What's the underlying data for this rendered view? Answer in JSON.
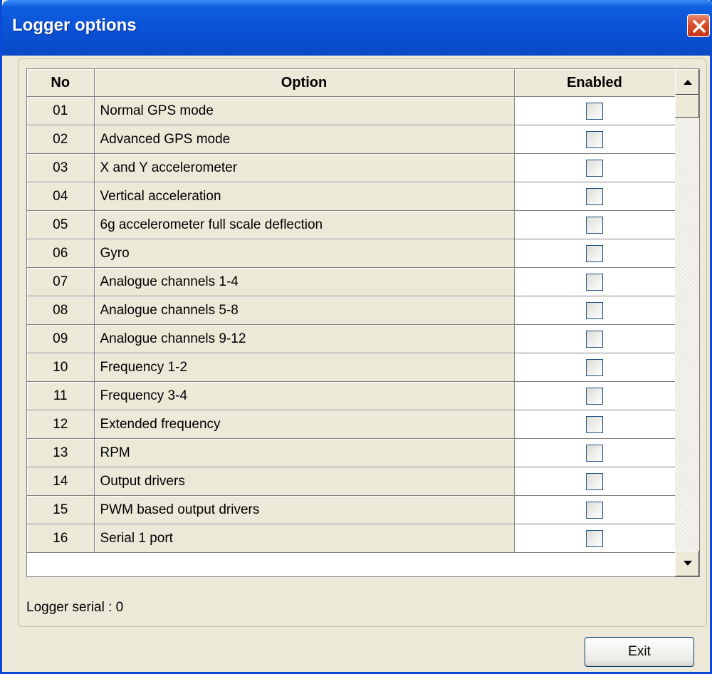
{
  "window": {
    "title": "Logger options"
  },
  "table": {
    "columns": [
      "No",
      "Option",
      "Enabled"
    ],
    "rows": [
      {
        "no": "01",
        "option": "Normal GPS mode",
        "enabled": false
      },
      {
        "no": "02",
        "option": "Advanced GPS mode",
        "enabled": false
      },
      {
        "no": "03",
        "option": "X and Y accelerometer",
        "enabled": false
      },
      {
        "no": "04",
        "option": "Vertical acceleration",
        "enabled": false
      },
      {
        "no": "05",
        "option": "6g accelerometer full scale deflection",
        "enabled": false
      },
      {
        "no": "06",
        "option": "Gyro",
        "enabled": false
      },
      {
        "no": "07",
        "option": "Analogue channels 1-4",
        "enabled": false
      },
      {
        "no": "08",
        "option": "Analogue channels 5-8",
        "enabled": false
      },
      {
        "no": "09",
        "option": "Analogue channels 9-12",
        "enabled": false
      },
      {
        "no": "10",
        "option": "Frequency 1-2",
        "enabled": false
      },
      {
        "no": "11",
        "option": "Frequency 3-4",
        "enabled": false
      },
      {
        "no": "12",
        "option": "Extended frequency",
        "enabled": false
      },
      {
        "no": "13",
        "option": "RPM",
        "enabled": false
      },
      {
        "no": "14",
        "option": "Output drivers",
        "enabled": false
      },
      {
        "no": "15",
        "option": "PWM based output drivers",
        "enabled": false
      },
      {
        "no": "16",
        "option": "Serial 1 port",
        "enabled": false
      }
    ]
  },
  "status": {
    "text": "Logger serial : 0"
  },
  "buttons": {
    "exit_label": "Exit"
  },
  "icons": {
    "close": "close-icon",
    "scroll_up": "arrow-up-icon",
    "scroll_down": "arrow-down-icon"
  },
  "colors": {
    "titlebar": "#0a52d6",
    "close": "#d84a24",
    "face": "#ece9d8"
  }
}
